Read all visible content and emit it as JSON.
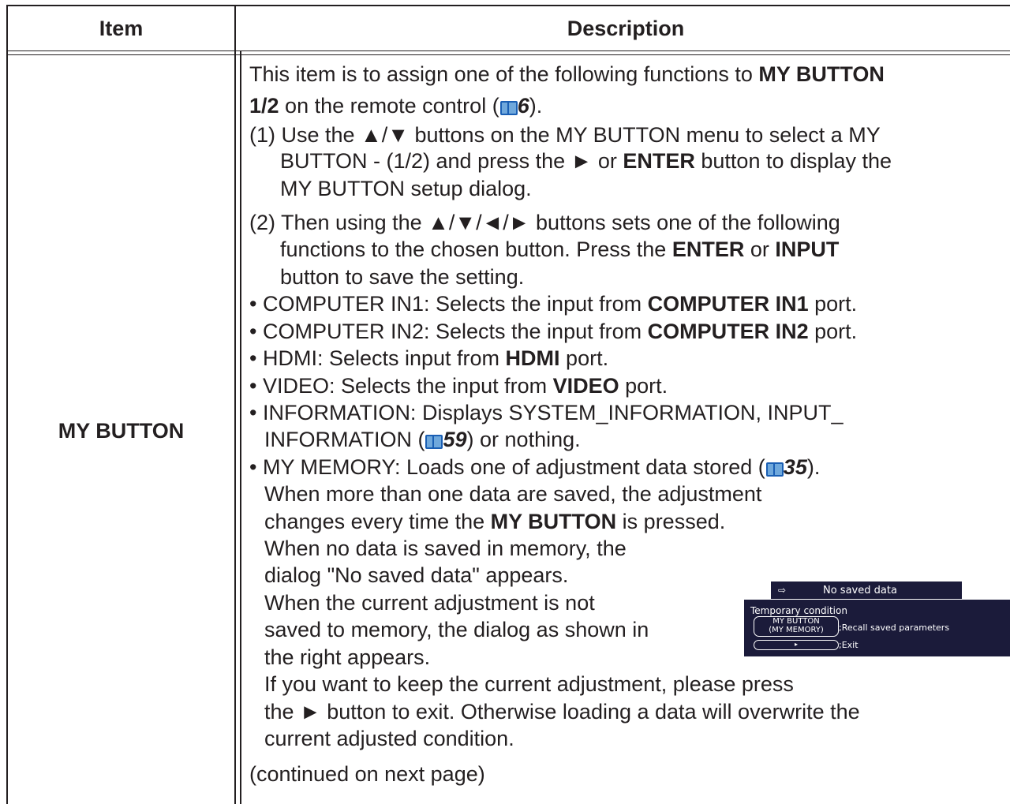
{
  "header": {
    "item": "Item",
    "description": "Description"
  },
  "row_label": "MY BUTTON",
  "lines": {
    "l1a": "This item is to assign one of the following functions to ",
    "l1b": "MY BUTTON",
    "l2a": "1/2",
    "l2b": " on the remote control (",
    "l2ref": "6",
    "l2c": ").",
    "l3": "(1) Use the ▲/▼ buttons on the MY BUTTON menu to select a MY",
    "l4a": "BUTTON - (1/2) and press the ► or ",
    "l4b": "ENTER",
    "l4c": " button to display the",
    "l5": "MY BUTTON setup dialog.",
    "l6": "(2) Then using the ▲/▼/◄/► buttons sets one of the following",
    "l7a": "functions to the chosen button. Press the ",
    "l7b": "ENTER",
    "l7c": " or ",
    "l7d": "INPUT",
    "l8": "button to save the setting.",
    "l9a": "• COMPUTER IN1: Selects the input from ",
    "l9b": "COMPUTER IN1",
    "l9c": " port.",
    "l10a": "• COMPUTER IN2: Selects the input from ",
    "l10b": "COMPUTER IN2",
    "l10c": " port.",
    "l11a": "• HDMI: Selects input from ",
    "l11b": "HDMI",
    "l11c": " port.",
    "l12a": "• VIDEO: Selects the input from ",
    "l12b": "VIDEO",
    "l12c": " port.",
    "l13": "• INFORMATION: Displays SYSTEM_INFORMATION, INPUT_",
    "l14a": "INFORMATION (",
    "l14ref": "59",
    "l14c": ") or nothing.",
    "l15a": "• MY MEMORY: Loads one of adjustment data stored (",
    "l15ref": "35",
    "l15c": ").",
    "l16": "When more than one data are saved, the adjustment",
    "l17a": "changes every time the ",
    "l17b": "MY BUTTON",
    "l17c": " is pressed.",
    "l18": "When no data is saved in memory, the",
    "l19": "dialog \"No saved data\" appears.",
    "l20": "When the current adjustment is not",
    "l21": "saved to memory, the dialog as shown in",
    "l22": "the right appears.",
    "l23": "If you want to keep the current adjustment, please press",
    "l24": "the ► button to exit. Otherwise loading a data will overwrite the",
    "l25": "current adjusted condition.",
    "l26": "(continued on next page)"
  },
  "dialog_no_data": {
    "icon": "⇨",
    "text": "No saved data"
  },
  "dialog_temp": {
    "title": "Temporary condition",
    "btn1_line1": "MY BUTTON",
    "btn1_line2": "(MY MEMORY)",
    "btn1_desc": ";Recall saved parameters",
    "btn2_label": "▸",
    "btn2_desc": ";Exit"
  },
  "icons": {
    "book": "book-icon"
  }
}
